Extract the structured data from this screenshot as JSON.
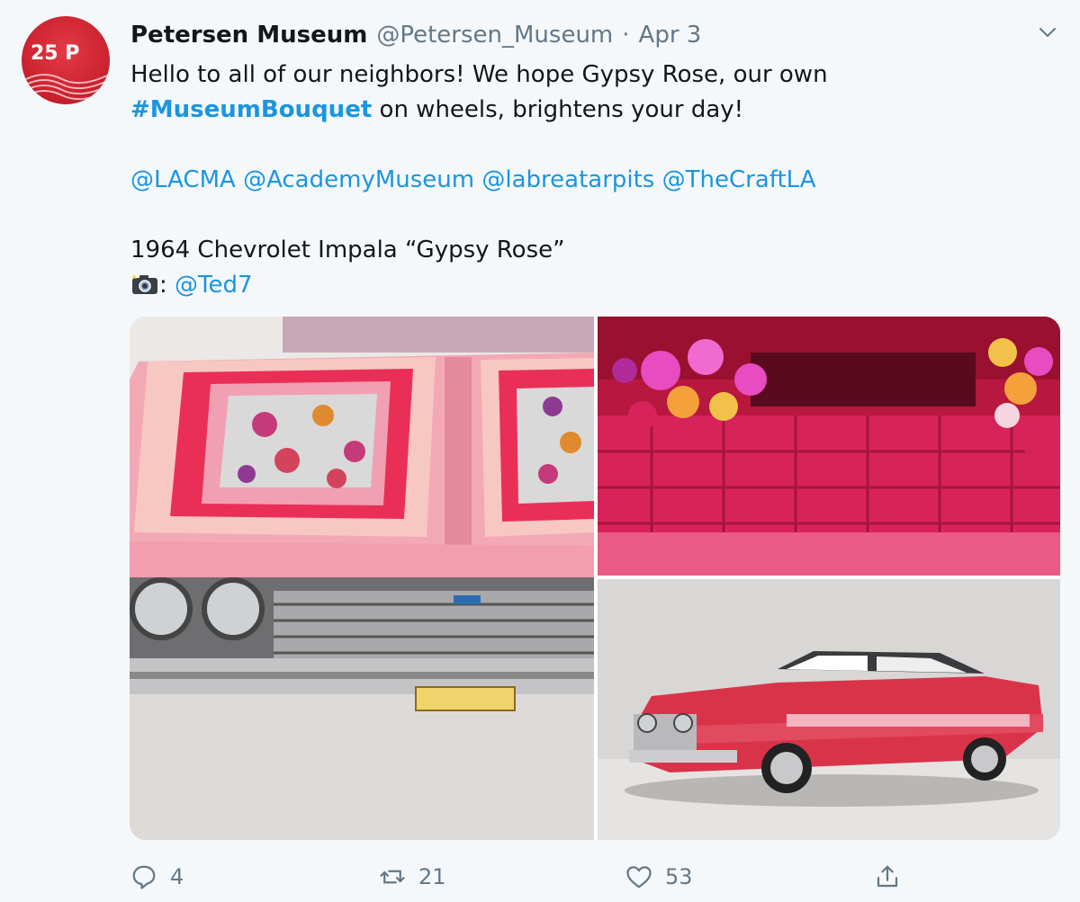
{
  "tweet": {
    "author_name": "Petersen Museum",
    "handle": "@Petersen_Museum",
    "separator": "·",
    "date": "Apr 3",
    "avatar_text": "25 P",
    "text": {
      "line1": "Hello to all of our neighbors! We hope Gypsy Rose, our own",
      "hashtag": "#MuseumBouquet",
      "line2_rest": " on wheels, brightens your day!",
      "mentions": [
        "@LACMA",
        "@AcademyMuseum",
        "@labreatarpits",
        "@TheCraftLA"
      ],
      "caption": "1964 Chevrolet Impala “Gypsy Rose”",
      "photo_credit_sep": ": ",
      "photo_credit": "@Ted7"
    },
    "media": [
      {
        "description_icon": "car-hood-photo"
      },
      {
        "description_icon": "car-interior-photo"
      },
      {
        "description_icon": "car-side-photo"
      }
    ],
    "actions": {
      "replies": "4",
      "retweets": "21",
      "likes": "53"
    }
  },
  "colors": {
    "link": "#1b95e0",
    "muted": "#657786",
    "background": "#f4f8fb",
    "brand_red": "#c8202c"
  }
}
